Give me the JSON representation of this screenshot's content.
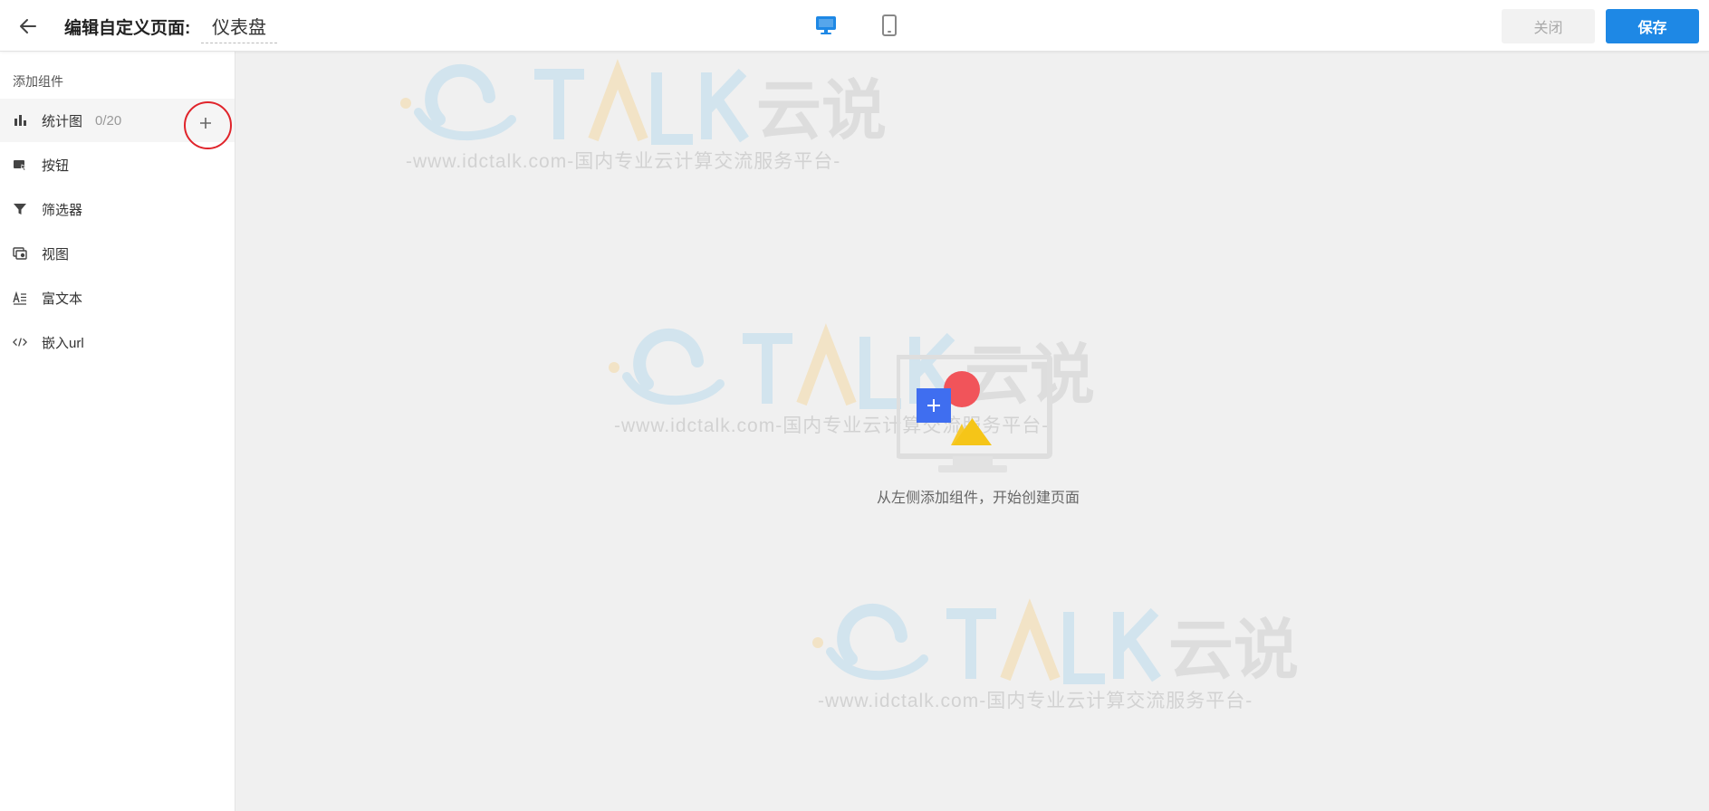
{
  "header": {
    "page_label": "编辑自定义页面:",
    "page_name": "仪表盘",
    "close_label": "关闭",
    "save_label": "保存",
    "accent_color": "#1e88e5"
  },
  "sidebar": {
    "heading": "添加组件",
    "items": [
      {
        "label": "统计图",
        "count": "0/20",
        "icon": "bar-chart-icon",
        "active": true
      },
      {
        "label": "按钮",
        "icon": "button-icon"
      },
      {
        "label": "筛选器",
        "icon": "filter-icon"
      },
      {
        "label": "视图",
        "icon": "view-icon"
      },
      {
        "label": "富文本",
        "icon": "rich-text-icon"
      },
      {
        "label": "嵌入url",
        "icon": "code-icon"
      }
    ]
  },
  "watermark": {
    "brand": "TALK",
    "brand_cn": "云说",
    "tagline": "-www.idctalk.com-国内专业云计算交流服务平台-"
  },
  "canvas": {
    "empty_message": "从左侧添加组件，开始创建页面"
  }
}
